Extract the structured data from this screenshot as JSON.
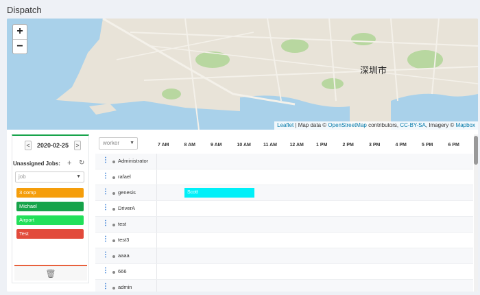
{
  "page": {
    "title": "Dispatch"
  },
  "map": {
    "zoom_in": "+",
    "zoom_out": "−",
    "city_label": "深圳市",
    "attribution": {
      "leaflet": "Leaflet",
      "text1": " | Map data © ",
      "osm": "OpenStreetMap",
      "text2": " contributors, ",
      "license": "CC-BY-SA",
      "text3": ", Imagery © ",
      "mapbox": "Mapbox"
    },
    "colors": {
      "water": "#a9d1ea",
      "land": "#e8e3d8",
      "road": "#f4f1ea",
      "park": "#b8d7a0"
    }
  },
  "sidebar": {
    "prev": "<",
    "date": "2020-02-25",
    "next": ">",
    "unassigned_label": "Unassigned Jobs:",
    "add_icon": "+",
    "refresh_icon": "↻",
    "job_select_placeholder": "job",
    "jobs": [
      {
        "label": "3 comp",
        "color": "#f59e0b"
      },
      {
        "label": "Michael",
        "color": "#16a34a"
      },
      {
        "label": "Airport",
        "color": "#22e05a"
      },
      {
        "label": "Test",
        "color": "#e24a3b"
      }
    ],
    "trash_icon": "🗑"
  },
  "schedule": {
    "worker_select_placeholder": "worker",
    "hours": [
      "7 AM",
      "8 AM",
      "9 AM",
      "10 AM",
      "11 AM",
      "12 AM",
      "1 PM",
      "2 PM",
      "3 PM",
      "4 PM",
      "5 PM",
      "6 PM"
    ],
    "workers": [
      "Administrator",
      "rafael",
      "genesis",
      "DriverA",
      "test",
      "test3",
      "aaaa",
      "666",
      "admin"
    ],
    "event": {
      "label": "Scott",
      "worker": "genesis",
      "color": "#00f0f8"
    }
  }
}
